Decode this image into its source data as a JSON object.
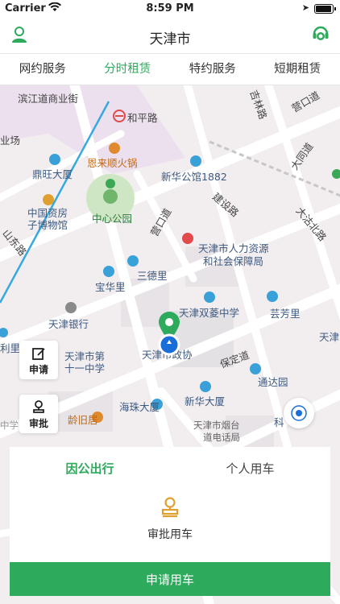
{
  "status_bar": {
    "carrier": "Carrier",
    "time": "8:59 PM"
  },
  "nav": {
    "title": "天津市"
  },
  "tabs": [
    {
      "label": "网约服务"
    },
    {
      "label": "分时租赁"
    },
    {
      "label": "特约服务"
    },
    {
      "label": "短期租赁"
    }
  ],
  "map": {
    "labels": [
      "滨江道商业街",
      "和平路",
      "吉林路",
      "营口道",
      "业场",
      "恩来顺火锅",
      "鼎旺大厦",
      "新华公馆1882",
      "大同道",
      "中国资房",
      "子博物馆",
      "中心公园",
      "营口道",
      "建设路",
      "大沽北路",
      "山东路",
      "天津市人力资源",
      "和社会保障局",
      "三德里",
      "宝华里",
      "天津双菱中学",
      "芸芳里",
      "天津银行",
      "天津",
      "利里",
      "天津市第",
      "十一中学",
      "天津市政协",
      "保定道",
      "通达园",
      "新华大厦",
      "海珠大厦",
      "龄旧居",
      "天津市烟台",
      "道电话局",
      "科",
      "中学"
    ]
  },
  "side_buttons": {
    "apply": "申请",
    "approve": "审批"
  },
  "panel": {
    "tab_public": "因公出行",
    "tab_personal": "个人用车",
    "approve_car": "审批用车"
  },
  "submit_label": "申请用车",
  "colors": {
    "accent": "#2eaa5c",
    "map_bg": "#f2eef0"
  }
}
